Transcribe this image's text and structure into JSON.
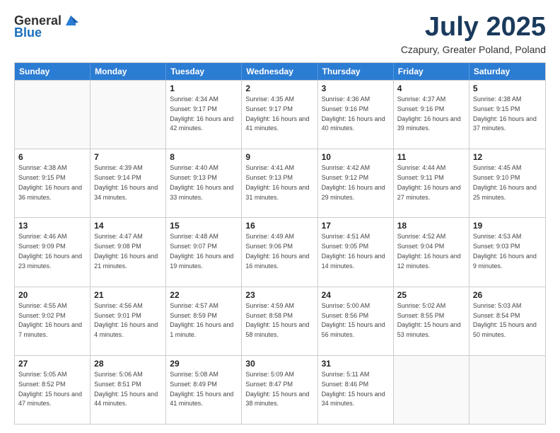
{
  "header": {
    "logo_general": "General",
    "logo_blue": "Blue",
    "title": "July 2025",
    "location": "Czapury, Greater Poland, Poland"
  },
  "days_of_week": [
    "Sunday",
    "Monday",
    "Tuesday",
    "Wednesday",
    "Thursday",
    "Friday",
    "Saturday"
  ],
  "weeks": [
    [
      {
        "day": "",
        "info": ""
      },
      {
        "day": "",
        "info": ""
      },
      {
        "day": "1",
        "info": "Sunrise: 4:34 AM\nSunset: 9:17 PM\nDaylight: 16 hours and 42 minutes."
      },
      {
        "day": "2",
        "info": "Sunrise: 4:35 AM\nSunset: 9:17 PM\nDaylight: 16 hours and 41 minutes."
      },
      {
        "day": "3",
        "info": "Sunrise: 4:36 AM\nSunset: 9:16 PM\nDaylight: 16 hours and 40 minutes."
      },
      {
        "day": "4",
        "info": "Sunrise: 4:37 AM\nSunset: 9:16 PM\nDaylight: 16 hours and 39 minutes."
      },
      {
        "day": "5",
        "info": "Sunrise: 4:38 AM\nSunset: 9:15 PM\nDaylight: 16 hours and 37 minutes."
      }
    ],
    [
      {
        "day": "6",
        "info": "Sunrise: 4:38 AM\nSunset: 9:15 PM\nDaylight: 16 hours and 36 minutes."
      },
      {
        "day": "7",
        "info": "Sunrise: 4:39 AM\nSunset: 9:14 PM\nDaylight: 16 hours and 34 minutes."
      },
      {
        "day": "8",
        "info": "Sunrise: 4:40 AM\nSunset: 9:13 PM\nDaylight: 16 hours and 33 minutes."
      },
      {
        "day": "9",
        "info": "Sunrise: 4:41 AM\nSunset: 9:13 PM\nDaylight: 16 hours and 31 minutes."
      },
      {
        "day": "10",
        "info": "Sunrise: 4:42 AM\nSunset: 9:12 PM\nDaylight: 16 hours and 29 minutes."
      },
      {
        "day": "11",
        "info": "Sunrise: 4:44 AM\nSunset: 9:11 PM\nDaylight: 16 hours and 27 minutes."
      },
      {
        "day": "12",
        "info": "Sunrise: 4:45 AM\nSunset: 9:10 PM\nDaylight: 16 hours and 25 minutes."
      }
    ],
    [
      {
        "day": "13",
        "info": "Sunrise: 4:46 AM\nSunset: 9:09 PM\nDaylight: 16 hours and 23 minutes."
      },
      {
        "day": "14",
        "info": "Sunrise: 4:47 AM\nSunset: 9:08 PM\nDaylight: 16 hours and 21 minutes."
      },
      {
        "day": "15",
        "info": "Sunrise: 4:48 AM\nSunset: 9:07 PM\nDaylight: 16 hours and 19 minutes."
      },
      {
        "day": "16",
        "info": "Sunrise: 4:49 AM\nSunset: 9:06 PM\nDaylight: 16 hours and 16 minutes."
      },
      {
        "day": "17",
        "info": "Sunrise: 4:51 AM\nSunset: 9:05 PM\nDaylight: 16 hours and 14 minutes."
      },
      {
        "day": "18",
        "info": "Sunrise: 4:52 AM\nSunset: 9:04 PM\nDaylight: 16 hours and 12 minutes."
      },
      {
        "day": "19",
        "info": "Sunrise: 4:53 AM\nSunset: 9:03 PM\nDaylight: 16 hours and 9 minutes."
      }
    ],
    [
      {
        "day": "20",
        "info": "Sunrise: 4:55 AM\nSunset: 9:02 PM\nDaylight: 16 hours and 7 minutes."
      },
      {
        "day": "21",
        "info": "Sunrise: 4:56 AM\nSunset: 9:01 PM\nDaylight: 16 hours and 4 minutes."
      },
      {
        "day": "22",
        "info": "Sunrise: 4:57 AM\nSunset: 8:59 PM\nDaylight: 16 hours and 1 minute."
      },
      {
        "day": "23",
        "info": "Sunrise: 4:59 AM\nSunset: 8:58 PM\nDaylight: 15 hours and 58 minutes."
      },
      {
        "day": "24",
        "info": "Sunrise: 5:00 AM\nSunset: 8:56 PM\nDaylight: 15 hours and 56 minutes."
      },
      {
        "day": "25",
        "info": "Sunrise: 5:02 AM\nSunset: 8:55 PM\nDaylight: 15 hours and 53 minutes."
      },
      {
        "day": "26",
        "info": "Sunrise: 5:03 AM\nSunset: 8:54 PM\nDaylight: 15 hours and 50 minutes."
      }
    ],
    [
      {
        "day": "27",
        "info": "Sunrise: 5:05 AM\nSunset: 8:52 PM\nDaylight: 15 hours and 47 minutes."
      },
      {
        "day": "28",
        "info": "Sunrise: 5:06 AM\nSunset: 8:51 PM\nDaylight: 15 hours and 44 minutes."
      },
      {
        "day": "29",
        "info": "Sunrise: 5:08 AM\nSunset: 8:49 PM\nDaylight: 15 hours and 41 minutes."
      },
      {
        "day": "30",
        "info": "Sunrise: 5:09 AM\nSunset: 8:47 PM\nDaylight: 15 hours and 38 minutes."
      },
      {
        "day": "31",
        "info": "Sunrise: 5:11 AM\nSunset: 8:46 PM\nDaylight: 15 hours and 34 minutes."
      },
      {
        "day": "",
        "info": ""
      },
      {
        "day": "",
        "info": ""
      }
    ]
  ]
}
